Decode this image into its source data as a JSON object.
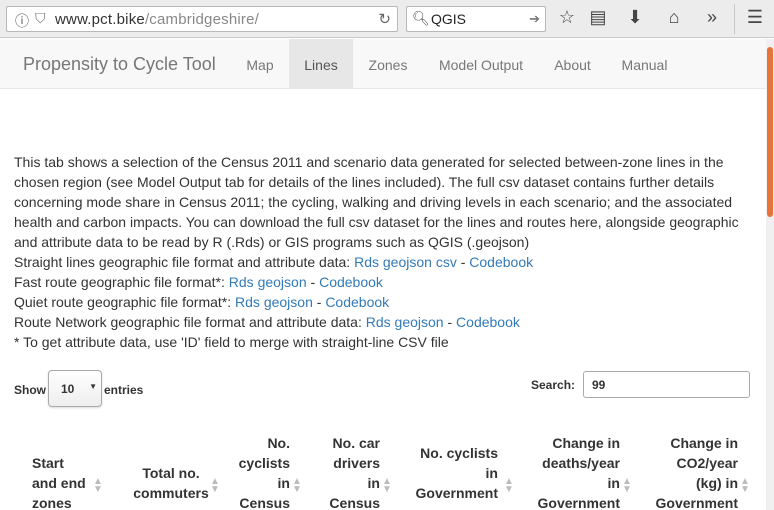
{
  "browser": {
    "url_host": "www.pct.bike",
    "url_path": "/cambridgeshire/",
    "search_value": "QGIS",
    "icons": [
      "info-icon",
      "shield-icon",
      "reload-icon",
      "search-icon",
      "arrow-right-icon",
      "star-icon",
      "reader-icon",
      "download-icon",
      "home-icon",
      "overflow-icon",
      "menu-icon"
    ]
  },
  "nav": {
    "brand": "Propensity to Cycle Tool",
    "items": [
      {
        "label": "Map"
      },
      {
        "label": "Lines"
      },
      {
        "label": "Zones"
      },
      {
        "label": "Model Output"
      },
      {
        "label": "About"
      },
      {
        "label": "Manual"
      }
    ],
    "active": "Lines"
  },
  "content": {
    "intro": "This tab shows a selection of the Census 2011 and scenario data generated for selected between-zone lines in the chosen region (see Model Output tab for details of the lines included). The full csv dataset contains further details concerning mode share in Census 2011; the cycling, walking and driving levels in each scenario; and the associated health and carbon impacts. You can download the full csv dataset for the lines and routes here, alongside geographic and attribute data to be read by R (.Rds) or GIS programs such as QGIS (.geojson)",
    "lines": [
      {
        "label": "Straight lines geographic file format and attribute data: ",
        "links": [
          "Rds",
          "geojson",
          "csv"
        ],
        "sep": " - ",
        "codebook": "Codebook"
      },
      {
        "label": "Fast route geographic file format*: ",
        "links": [
          "Rds",
          "geojson"
        ],
        "sep": " - ",
        "codebook": "Codebook"
      },
      {
        "label": "Quiet route geographic file format*: ",
        "links": [
          "Rds",
          "geojson"
        ],
        "sep": " - ",
        "codebook": "Codebook"
      },
      {
        "label": "Route Network geographic file format and attribute data: ",
        "links": [
          "Rds",
          "geojson"
        ],
        "sep": " - ",
        "codebook": "Codebook"
      }
    ],
    "footnote": "* To get attribute data, use 'ID' field to merge with straight-line CSV file"
  },
  "table_controls": {
    "show_label": "Show",
    "entries_value": "10",
    "entries_label": "entries",
    "search_label": "Search:",
    "search_value": "99"
  },
  "table": {
    "headers": [
      "Start\nand end\nzones",
      "Total no.\ncommuters",
      "No.\ncyclists\nin\nCensus",
      "No. car\ndrivers\nin\nCensus",
      "No. cyclists\nin\nGovernment",
      "Change in\ndeaths/year\nin\nGovernment",
      "Change in\nCO2/year\n(kg) in\nGovernment"
    ]
  }
}
